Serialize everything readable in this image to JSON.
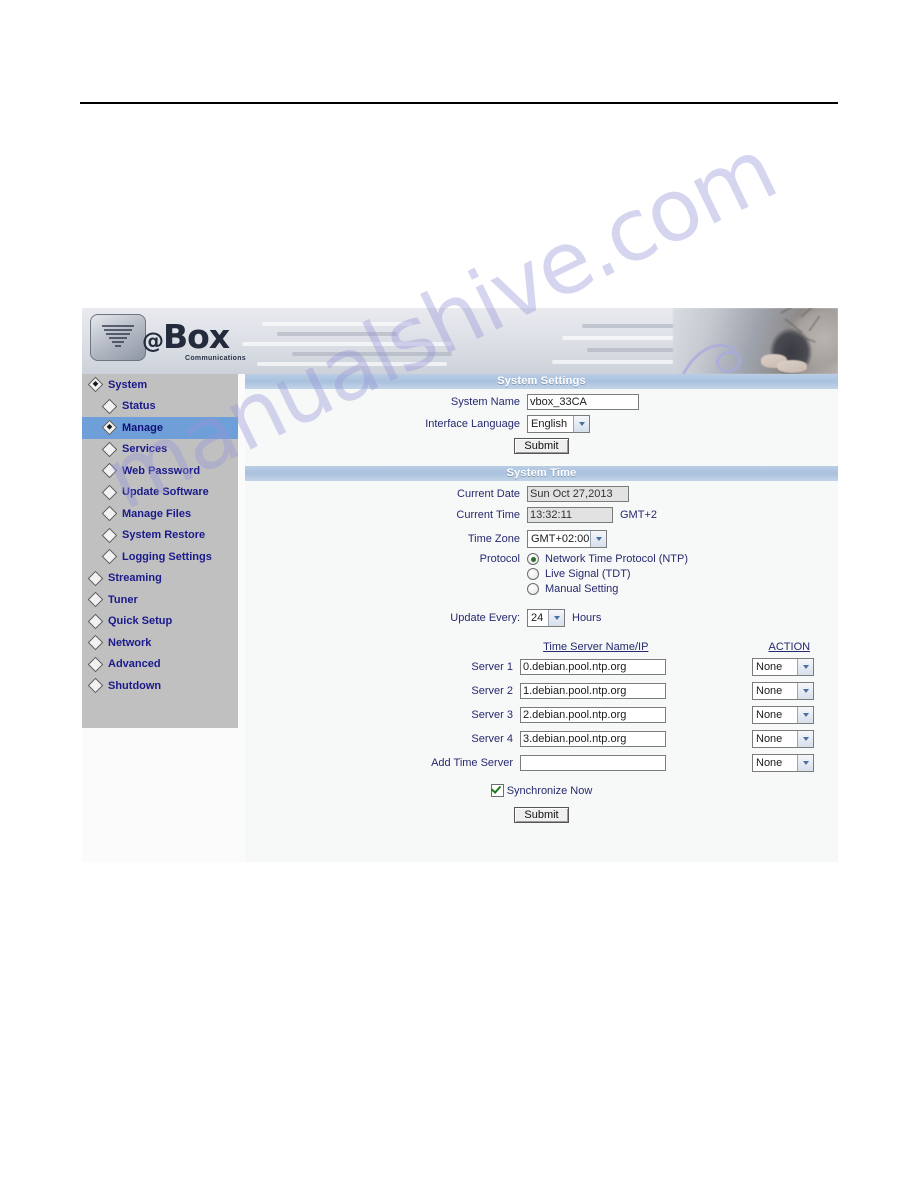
{
  "watermark": {
    "text": "manualshive.com"
  },
  "banner": {
    "logo_at": "@",
    "logo_box": "Box",
    "logo_sub": "Communications"
  },
  "sidebar": {
    "items": [
      {
        "label": "System",
        "level": 1,
        "active": false,
        "filled": true
      },
      {
        "label": "Status",
        "level": 2,
        "active": false,
        "filled": false
      },
      {
        "label": "Manage",
        "level": 2,
        "active": true,
        "filled": true
      },
      {
        "label": "Services",
        "level": 2,
        "active": false,
        "filled": false
      },
      {
        "label": "Web Password",
        "level": 2,
        "active": false,
        "filled": false
      },
      {
        "label": "Update Software",
        "level": 2,
        "active": false,
        "filled": false
      },
      {
        "label": "Manage Files",
        "level": 2,
        "active": false,
        "filled": false
      },
      {
        "label": "System Restore",
        "level": 2,
        "active": false,
        "filled": false
      },
      {
        "label": "Logging Settings",
        "level": 2,
        "active": false,
        "filled": false
      },
      {
        "label": "Streaming",
        "level": 1,
        "active": false,
        "filled": false
      },
      {
        "label": "Tuner",
        "level": 1,
        "active": false,
        "filled": false
      },
      {
        "label": "Quick Setup",
        "level": 1,
        "active": false,
        "filled": false
      },
      {
        "label": "Network",
        "level": 1,
        "active": false,
        "filled": false
      },
      {
        "label": "Advanced",
        "level": 1,
        "active": false,
        "filled": false
      },
      {
        "label": "Shutdown",
        "level": 1,
        "active": false,
        "filled": false
      }
    ]
  },
  "system_settings": {
    "title": "System Settings",
    "system_name_label": "System Name",
    "system_name_value": "vbox_33CA",
    "interface_language_label": "Interface Language",
    "interface_language_value": "English",
    "submit_label": "Submit"
  },
  "system_time": {
    "title": "System Time",
    "current_date_label": "Current Date",
    "current_date_value": "Sun Oct 27,2013",
    "current_time_label": "Current Time",
    "current_time_value": "13:32:11",
    "current_time_suffix": "GMT+2",
    "time_zone_label": "Time Zone",
    "time_zone_value": "GMT+02:00",
    "protocol_label": "Protocol",
    "protocol_options": [
      {
        "label": "Network Time Protocol (NTP)",
        "selected": true
      },
      {
        "label": "Live Signal (TDT)",
        "selected": false
      },
      {
        "label": "Manual Setting",
        "selected": false
      }
    ],
    "update_every_label": "Update Every:",
    "update_every_value": "24",
    "update_every_unit": "Hours",
    "server_column_header": "Time Server Name/IP",
    "action_column_header": "ACTION",
    "servers": [
      {
        "label": "Server 1",
        "value": "0.debian.pool.ntp.org",
        "action": "None"
      },
      {
        "label": "Server 2",
        "value": "1.debian.pool.ntp.org",
        "action": "None"
      },
      {
        "label": "Server 3",
        "value": "2.debian.pool.ntp.org",
        "action": "None"
      },
      {
        "label": "Server 4",
        "value": "3.debian.pool.ntp.org",
        "action": "None"
      },
      {
        "label": "Add Time Server",
        "value": "",
        "action": "None"
      }
    ],
    "synchronize_label": "Synchronize Now",
    "synchronize_checked": true,
    "submit_label": "Submit"
  },
  "colors": {
    "sidebar_bg": "#c0c0c0",
    "nav_text": "#1a1a8c",
    "nav_active_bg": "#6f9fd8",
    "section_header_bg": "#a9c1dd",
    "label_text": "#262a6e",
    "watermark": "#9696d7"
  }
}
